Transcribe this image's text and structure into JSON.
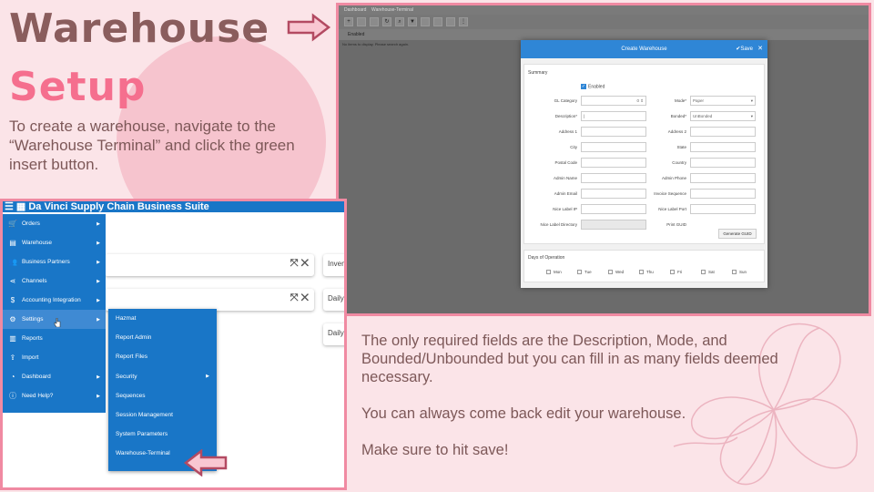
{
  "slide": {
    "title_line1": "Warehouse",
    "title_line2": "Setup",
    "intro": "To create a warehouse, navigate to the “Warehouse Terminal” and click the green insert button.",
    "paragraph1": "The only required fields are the Description, Mode, and Bounded/Unbounded but you can fill in as many fields deemed necessary.",
    "paragraph2": " You can always come back edit your warehouse.",
    "paragraph3": "Make sure to hit save!"
  },
  "colors": {
    "background": "#fbe4e8",
    "title_dark": "#8a5d5d",
    "title_pink": "#f56f8e",
    "frame": "#f08aa2",
    "app_blue": "#1976c7"
  },
  "right_screenshot": {
    "tabs": [
      "Dashboard",
      "Warehouse-Terminal"
    ],
    "sub_label": "Enabled",
    "no_data": "No items to display. Please search again.",
    "modal": {
      "title": "Create Warehouse",
      "save_label": "Save",
      "summary_label": "Summary",
      "enabled_label": "Enabled",
      "gl_category_label": "GL Category",
      "gl_category_value": "0",
      "mode_label": "Mode*",
      "mode_value": "Paper",
      "description_label": "Description*",
      "bonded_label": "Bonded*",
      "bonded_value": "UnBonded",
      "address1_label": "Address 1",
      "address2_label": "Address 2",
      "city_label": "City",
      "state_label": "State",
      "postal_label": "Postal Code",
      "country_label": "Country",
      "admin_name_label": "Admin Name",
      "admin_phone_label": "Admin Phone",
      "admin_email_label": "Admin Email",
      "invoice_seq_label": "Invoice Sequence",
      "nice_ip_label": "Nice Label IP",
      "nice_port_label": "Nice Label Port",
      "nice_dir_label": "Nice Label Directory",
      "print_guid_label": "Print GUID",
      "generate_guid": "Generate GUID",
      "days_label": "Days of Operation",
      "days": [
        "Mon",
        "Tue",
        "Wed",
        "Thu",
        "Fri",
        "Sat",
        "Sun"
      ]
    }
  },
  "left_screenshot": {
    "app_title": "Da Vinci Supply Chain Business Suite",
    "menu": [
      {
        "label": "Orders",
        "icon": "cart-icon"
      },
      {
        "label": "Warehouse",
        "icon": "warehouse-icon"
      },
      {
        "label": "Business Partners",
        "icon": "people-icon"
      },
      {
        "label": "Channels",
        "icon": "share-icon"
      },
      {
        "label": "Accounting Integration",
        "icon": "dollar-icon"
      },
      {
        "label": "Settings",
        "icon": "gear-icon"
      },
      {
        "label": "Reports",
        "icon": "chart-icon"
      },
      {
        "label": "Import",
        "icon": "upload-icon"
      },
      {
        "label": "Dashboard",
        "icon": "speedometer-icon"
      },
      {
        "label": "Need Help?",
        "icon": "info-icon"
      }
    ],
    "submenu": [
      "Hazmat",
      "Report Admin",
      "Report Files",
      "Security",
      "Sequences",
      "Session Management",
      "System Parameters",
      "Warehouse-Terminal"
    ],
    "card_labels": [
      "Inven",
      "Daily",
      "Daily"
    ]
  }
}
